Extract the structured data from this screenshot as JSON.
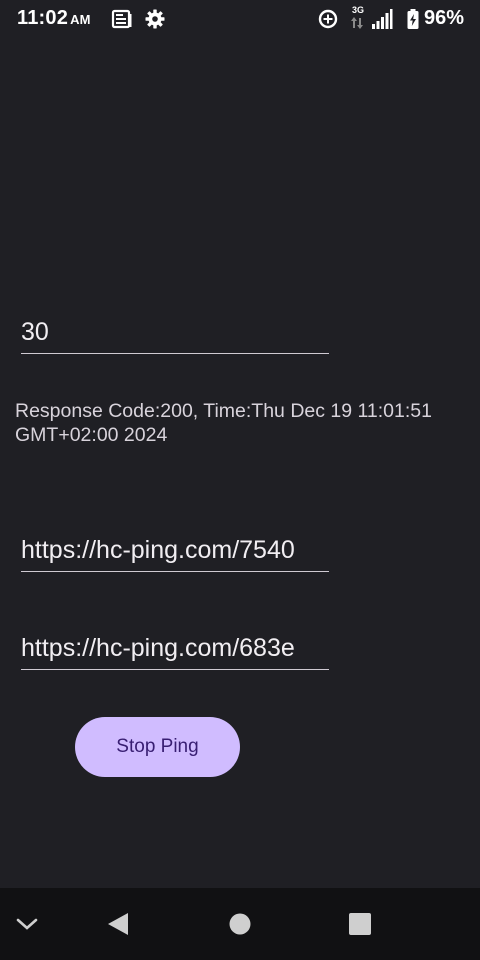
{
  "status_bar": {
    "time": "11:02",
    "ampm": "AM",
    "network_label": "3G",
    "battery_percent": "96%",
    "icons": [
      "news-icon",
      "settings-gear-icon",
      "data-saver-icon",
      "network-arrows-icon",
      "signal-icon",
      "battery-charging-icon"
    ]
  },
  "interval_field": {
    "value": "30"
  },
  "response": {
    "text": "Response Code:200, Time:Thu Dec 19 11:01:51 GMT+02:00 2024"
  },
  "url_fields": [
    {
      "value": "https://hc-ping.com/7540"
    },
    {
      "value": "https://hc-ping.com/683e"
    }
  ],
  "actions": {
    "stop_label": "Stop Ping"
  },
  "nav_bar": {
    "icons": [
      "collapse-chevron-icon",
      "back-icon",
      "home-icon",
      "recents-icon"
    ]
  },
  "colors": {
    "background": "#1f1f24",
    "button_bg": "#d0bcff",
    "button_text": "#381e72",
    "nav_bg": "#111113"
  }
}
